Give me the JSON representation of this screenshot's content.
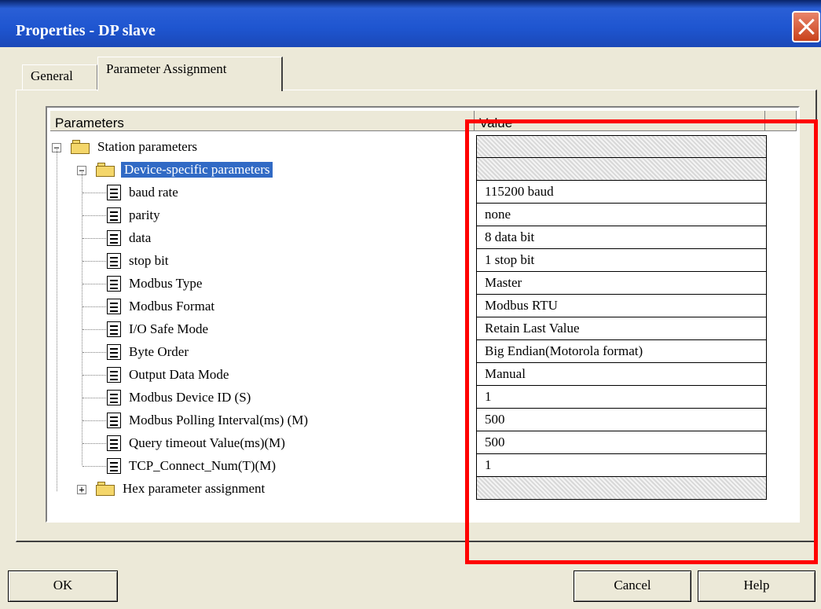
{
  "window": {
    "title": "Properties - DP slave"
  },
  "tabs": [
    {
      "label": "General"
    },
    {
      "label": "Parameter Assignment"
    }
  ],
  "table": {
    "headers": {
      "parameters": "Parameters",
      "value": "Value"
    },
    "station": {
      "label": "Station parameters"
    },
    "device": {
      "label": "Device-specific parameters"
    },
    "rows": [
      {
        "name": "baud rate",
        "value": "115200 baud"
      },
      {
        "name": "parity",
        "value": "none"
      },
      {
        "name": "data",
        "value": "8 data bit"
      },
      {
        "name": "stop bit",
        "value": "1 stop bit"
      },
      {
        "name": "Modbus Type",
        "value": "Master"
      },
      {
        "name": "Modbus Format",
        "value": "Modbus RTU"
      },
      {
        "name": "I/O Safe Mode",
        "value": "Retain Last Value"
      },
      {
        "name": "Byte Order",
        "value": "Big Endian(Motorola  format)"
      },
      {
        "name": "Output Data Mode",
        "value": "Manual"
      },
      {
        "name": "Modbus Device ID (S)",
        "value": "1"
      },
      {
        "name": "Modbus Polling Interval(ms) (M)",
        "value": "500"
      },
      {
        "name": "Query timeout Value(ms)(M)",
        "value": "500"
      },
      {
        "name": "TCP_Connect_Num(T)(M)",
        "value": "1"
      }
    ],
    "hex": {
      "label": "Hex parameter assignment"
    }
  },
  "buttons": {
    "ok": "OK",
    "cancel": "Cancel",
    "help": "Help"
  },
  "icons": {
    "close": "close-icon",
    "folder": "folder-icon",
    "param": "parameter-icon"
  },
  "colors": {
    "titlebar": "#1E55D0",
    "selection": "#316AC5",
    "highlight": "#FF0000"
  }
}
